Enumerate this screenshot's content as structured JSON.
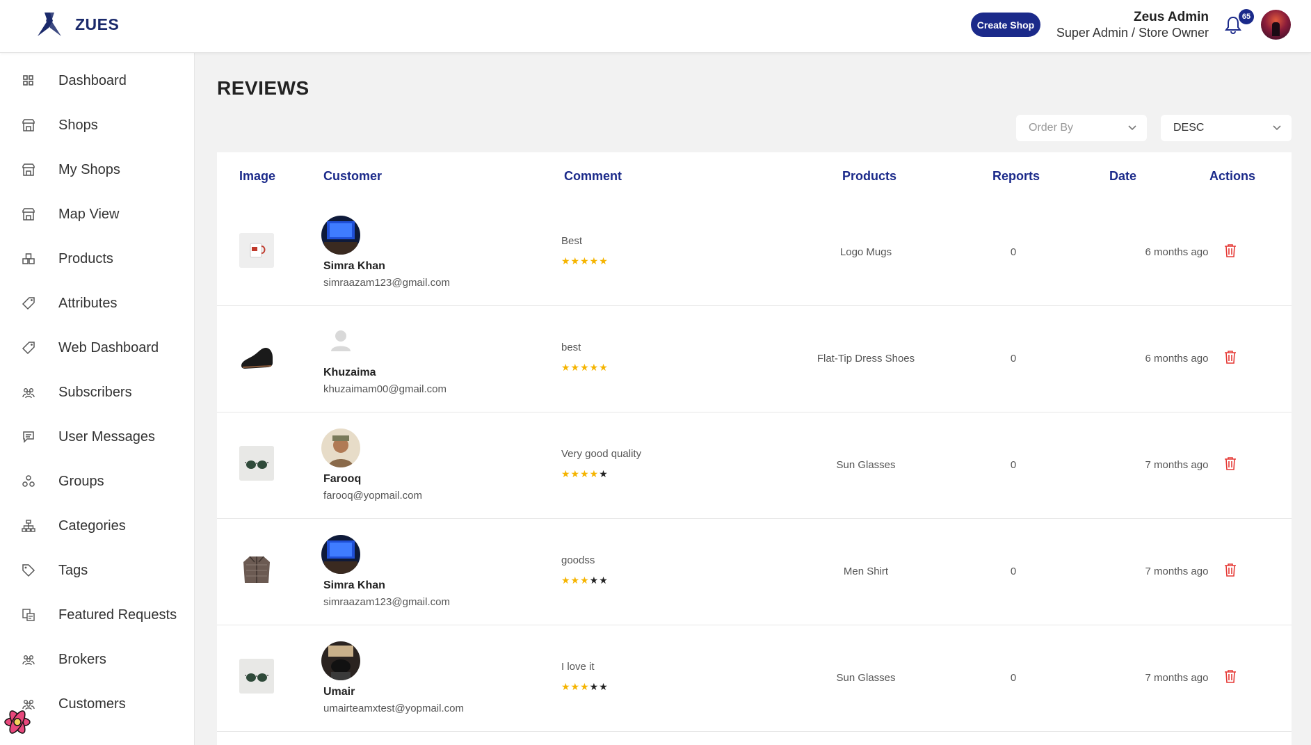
{
  "brand": {
    "name": "ZUES"
  },
  "header": {
    "create_shop_label": "Create Shop",
    "user_name": "Zeus Admin",
    "user_role": "Super Admin / Store Owner",
    "notification_count": "65"
  },
  "sidebar": {
    "items": [
      {
        "label": "Dashboard",
        "icon": "grid-icon"
      },
      {
        "label": "Shops",
        "icon": "store-icon"
      },
      {
        "label": "My Shops",
        "icon": "store-icon"
      },
      {
        "label": "Map View",
        "icon": "store-icon"
      },
      {
        "label": "Products",
        "icon": "boxes-icon"
      },
      {
        "label": "Attributes",
        "icon": "tag-icon"
      },
      {
        "label": "Web Dashboard",
        "icon": "tag-icon"
      },
      {
        "label": "Subscribers",
        "icon": "users-icon"
      },
      {
        "label": "User Messages",
        "icon": "message-icon"
      },
      {
        "label": "Groups",
        "icon": "groups-icon"
      },
      {
        "label": "Categories",
        "icon": "hierarchy-icon"
      },
      {
        "label": "Tags",
        "icon": "tag-outline-icon"
      },
      {
        "label": "Featured Requests",
        "icon": "featured-icon"
      },
      {
        "label": "Brokers",
        "icon": "users-icon"
      },
      {
        "label": "Customers",
        "icon": "users-icon"
      }
    ]
  },
  "page": {
    "title": "REVIEWS",
    "order_by_placeholder": "Order By",
    "sort_direction": "DESC"
  },
  "table": {
    "columns": [
      "Image",
      "Customer",
      "Comment",
      "Products",
      "Reports",
      "Date",
      "Actions"
    ],
    "rows": [
      {
        "customer_name": "Simra Khan",
        "customer_email": "simraazam123@gmail.com",
        "comment": "Best",
        "rating": 5,
        "product": "Logo Mugs",
        "reports": "0",
        "date": "6 months ago",
        "stars": "★★★★★",
        "stars_off": ""
      },
      {
        "customer_name": "Khuzaima",
        "customer_email": "khuzaimam00@gmail.com",
        "comment": "best",
        "rating": 5,
        "product": "Flat-Tip Dress Shoes",
        "reports": "0",
        "date": "6 months ago",
        "stars": "★★★★★",
        "stars_off": ""
      },
      {
        "customer_name": "Farooq",
        "customer_email": "farooq@yopmail.com",
        "comment": "Very good quality",
        "rating": 4,
        "product": "Sun Glasses",
        "reports": "0",
        "date": "7 months ago",
        "stars": "★★★★",
        "stars_off": "★"
      },
      {
        "customer_name": "Simra Khan",
        "customer_email": "simraazam123@gmail.com",
        "comment": "goodss",
        "rating": 3,
        "product": "Men Shirt",
        "reports": "0",
        "date": "7 months ago",
        "stars": "★★★",
        "stars_off": "★★"
      },
      {
        "customer_name": "Umair",
        "customer_email": "umairteamxtest@yopmail.com",
        "comment": "I love it",
        "rating": 3,
        "product": "Sun Glasses",
        "reports": "0",
        "date": "7 months ago",
        "stars": "★★★",
        "stars_off": "★★"
      }
    ]
  },
  "colors": {
    "accent": "#1b2a8a",
    "star": "#f5b400",
    "delete": "#e53935"
  }
}
